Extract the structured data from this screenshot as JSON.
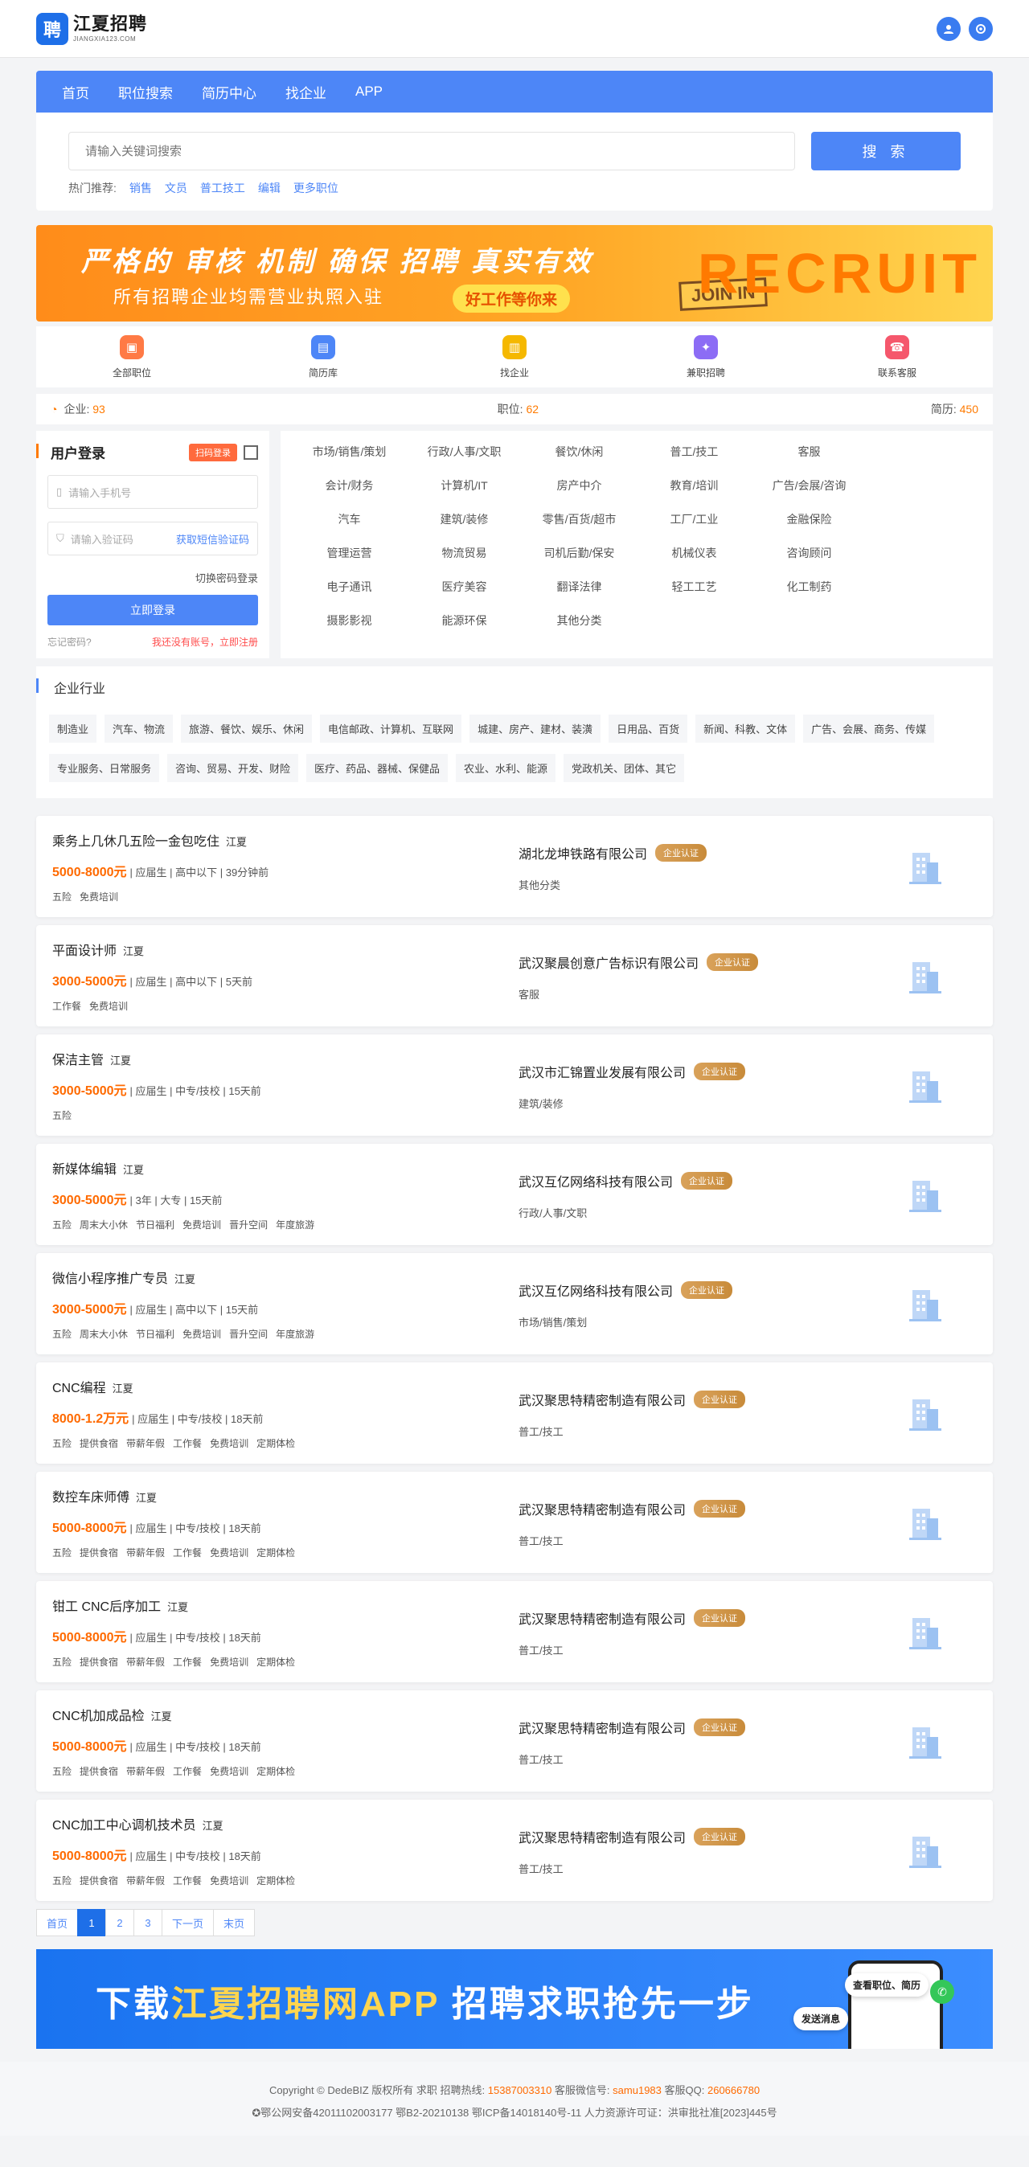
{
  "header": {
    "logo_mark": "聘",
    "logo_cn": "江夏招聘",
    "logo_en": "JIANGXIA123.COM"
  },
  "nav": [
    "首页",
    "职位搜索",
    "简历中心",
    "找企业",
    "APP"
  ],
  "search": {
    "placeholder": "请输入关键词搜索",
    "button": "搜 索",
    "hot_label": "热门推荐:",
    "hot_items": [
      "销售",
      "文员",
      "普工技工",
      "编辑",
      "更多职位"
    ]
  },
  "banner": {
    "line1": "严格的 审核 机制  确保 招聘 真实有效",
    "line2": "所有招聘企业均需营业执照入驻",
    "pill": "好工作等你来",
    "join": "JOIN IN",
    "recruit": "RECRUIT"
  },
  "quick": [
    {
      "label": "全部职位",
      "color": "#ff7a45"
    },
    {
      "label": "简历库",
      "color": "#4d86f7"
    },
    {
      "label": "找企业",
      "color": "#f5b800"
    },
    {
      "label": "兼职招聘",
      "color": "#8c6cf5"
    },
    {
      "label": "联系客服",
      "color": "#f5576c"
    }
  ],
  "stats": {
    "company_label": "企业:",
    "company_num": "93",
    "job_label": "职位:",
    "job_num": "62",
    "resume_label": "简历:",
    "resume_num": "450"
  },
  "login": {
    "title": "用户登录",
    "scan": "扫码登录",
    "phone_ph": "请输入手机号",
    "code_ph": "请输入验证码",
    "sms": "获取短信验证码",
    "switch": "切换密码登录",
    "button": "立即登录",
    "forgot": "忘记密码?",
    "register": "我还没有账号，立即注册"
  },
  "categories": [
    "市场/销售/策划",
    "行政/人事/文职",
    "餐饮/休闲",
    "普工/技工",
    "客服",
    "",
    "会计/财务",
    "计算机/IT",
    "房产中介",
    "教育/培训",
    "广告/会展/咨询",
    "",
    "汽车",
    "建筑/装修",
    "零售/百货/超市",
    "工厂/工业",
    "金融保险",
    "",
    "管理运营",
    "物流贸易",
    "司机后勤/保安",
    "机械仪表",
    "咨询顾问",
    "",
    "电子通讯",
    "医疗美容",
    "翻译法律",
    "轻工工艺",
    "化工制药",
    "",
    "摄影影视",
    "能源环保",
    "其他分类",
    "",
    "",
    ""
  ],
  "industry": {
    "title": "企业行业",
    "tags": [
      "制造业",
      "汽车、物流",
      "旅游、餐饮、娱乐、休闲",
      "电信邮政、计算机、互联网",
      "城建、房产、建材、装潢",
      "日用品、百货",
      "新闻、科教、文体",
      "广告、会展、商务、传媒",
      "专业服务、日常服务",
      "咨询、贸易、开发、财险",
      "医疗、药品、器械、保健品",
      "农业、水利、能源",
      "党政机关、团体、其它"
    ]
  },
  "jobs": [
    {
      "title": "乘务上几休几五险一金包吃住",
      "loc": "江夏",
      "salary": "5000-8000元",
      "meta": "| 应届生 | 高中以下 | 39分钟前",
      "perks": [
        "五险",
        "免费培训"
      ],
      "company": "湖北龙坤铁路有限公司",
      "badge": "企业认证",
      "cat": "其他分类"
    },
    {
      "title": "平面设计师",
      "loc": "江夏",
      "salary": "3000-5000元",
      "meta": "| 应届生 | 高中以下 | 5天前",
      "perks": [
        "工作餐",
        "免费培训"
      ],
      "company": "武汉聚晨创意广告标识有限公司",
      "badge": "企业认证",
      "cat": "客服"
    },
    {
      "title": "保洁主管",
      "loc": "江夏",
      "salary": "3000-5000元",
      "meta": "| 应届生 | 中专/技校 | 15天前",
      "perks": [
        "五险"
      ],
      "company": "武汉市汇锦置业发展有限公司",
      "badge": "企业认证",
      "cat": "建筑/装修"
    },
    {
      "title": "新媒体编辑",
      "loc": "江夏",
      "salary": "3000-5000元",
      "meta": "| 3年 | 大专 | 15天前",
      "perks": [
        "五险",
        "周末大小休",
        "节日福利",
        "免费培训",
        "晋升空间",
        "年度旅游"
      ],
      "company": "武汉互亿网络科技有限公司",
      "badge": "企业认证",
      "cat": "行政/人事/文职"
    },
    {
      "title": "微信小程序推广专员",
      "loc": "江夏",
      "salary": "3000-5000元",
      "meta": "| 应届生 | 高中以下 | 15天前",
      "perks": [
        "五险",
        "周末大小休",
        "节日福利",
        "免费培训",
        "晋升空间",
        "年度旅游"
      ],
      "company": "武汉互亿网络科技有限公司",
      "badge": "企业认证",
      "cat": "市场/销售/策划"
    },
    {
      "title": "CNC编程",
      "loc": "江夏",
      "salary": "8000-1.2万元",
      "meta": "| 应届生 | 中专/技校 | 18天前",
      "perks": [
        "五险",
        "提供食宿",
        "带薪年假",
        "工作餐",
        "免费培训",
        "定期体检"
      ],
      "company": "武汉聚思特精密制造有限公司",
      "badge": "企业认证",
      "cat": "普工/技工"
    },
    {
      "title": "数控车床师傅",
      "loc": "江夏",
      "salary": "5000-8000元",
      "meta": "| 应届生 | 中专/技校 | 18天前",
      "perks": [
        "五险",
        "提供食宿",
        "带薪年假",
        "工作餐",
        "免费培训",
        "定期体检"
      ],
      "company": "武汉聚思特精密制造有限公司",
      "badge": "企业认证",
      "cat": "普工/技工"
    },
    {
      "title": "钳工 CNC后序加工",
      "loc": "江夏",
      "salary": "5000-8000元",
      "meta": "| 应届生 | 中专/技校 | 18天前",
      "perks": [
        "五险",
        "提供食宿",
        "带薪年假",
        "工作餐",
        "免费培训",
        "定期体检"
      ],
      "company": "武汉聚思特精密制造有限公司",
      "badge": "企业认证",
      "cat": "普工/技工"
    },
    {
      "title": "CNC机加成品检",
      "loc": "江夏",
      "salary": "5000-8000元",
      "meta": "| 应届生 | 中专/技校 | 18天前",
      "perks": [
        "五险",
        "提供食宿",
        "带薪年假",
        "工作餐",
        "免费培训",
        "定期体检"
      ],
      "company": "武汉聚思特精密制造有限公司",
      "badge": "企业认证",
      "cat": "普工/技工"
    },
    {
      "title": "CNC加工中心调机技术员",
      "loc": "江夏",
      "salary": "5000-8000元",
      "meta": "| 应届生 | 中专/技校 | 18天前",
      "perks": [
        "五险",
        "提供食宿",
        "带薪年假",
        "工作餐",
        "免费培训",
        "定期体检"
      ],
      "company": "武汉聚思特精密制造有限公司",
      "badge": "企业认证",
      "cat": "普工/技工"
    }
  ],
  "pager": [
    "首页",
    "1",
    "2",
    "3",
    "下一页",
    "末页"
  ],
  "app_banner": {
    "pre": "下载",
    "highlight": "江夏招聘网APP",
    "post": " 招聘求职抢先一步",
    "note": "查看职位、简历",
    "send": "发送消息"
  },
  "footer": {
    "copy": "Copyright © DedeBIZ 版权所有 求职 招聘热线:",
    "hotline": "15387003310",
    "wx_label": " 客服微信号:",
    "wx": "samu1983",
    "qq_label": " 客服QQ:",
    "qq": "260666780",
    "icp": "鄂公网安备42011102003177 鄂B2-20210138 鄂ICP备14018140号-11 人力资源许可证：洪审批社准[2023]445号"
  },
  "colors": {
    "primary": "#4d86f7",
    "accent": "#ff7a00",
    "badge": "#d9a25b"
  }
}
